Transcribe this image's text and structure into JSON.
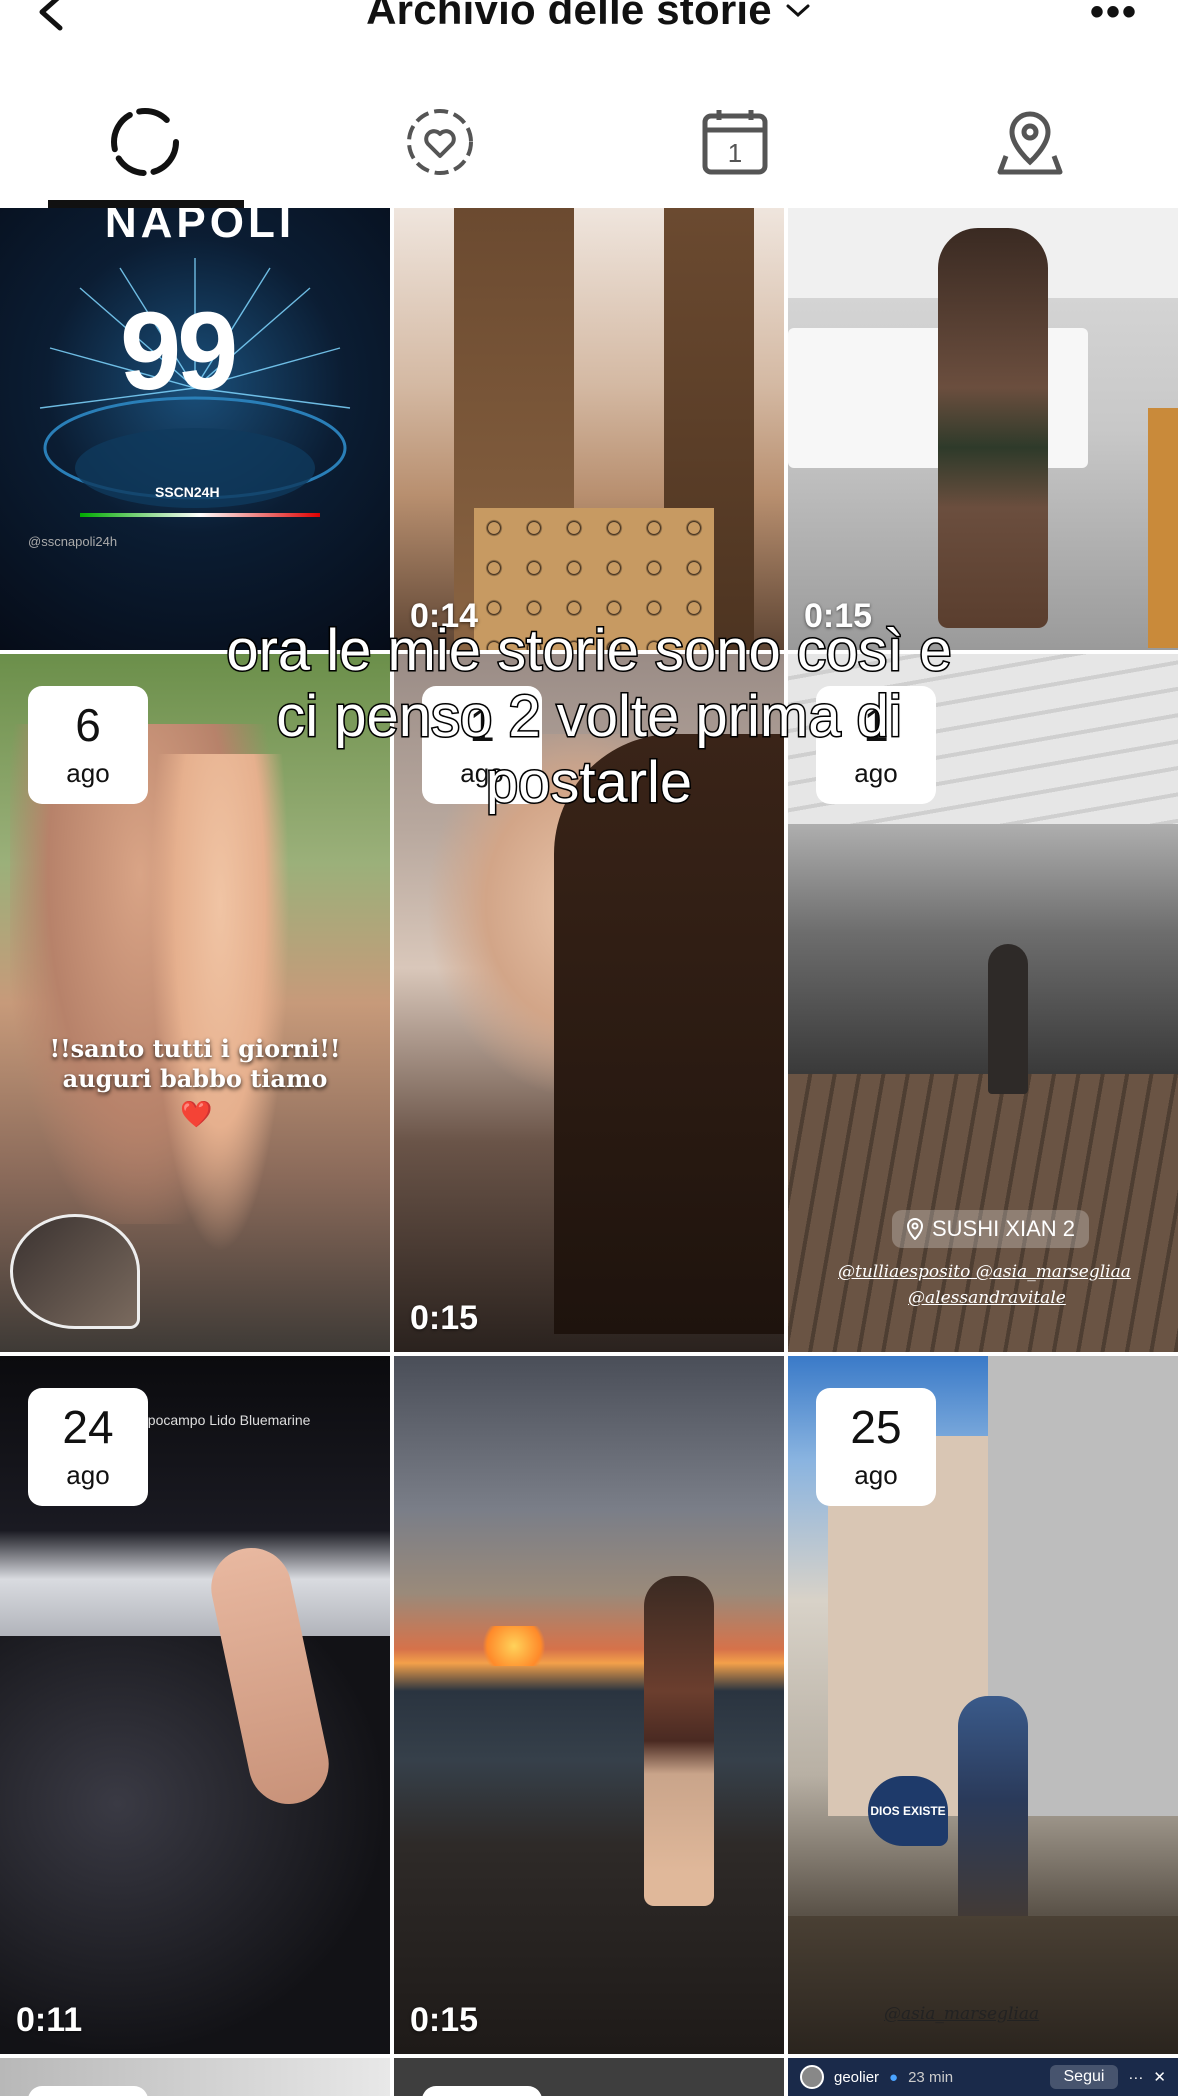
{
  "header": {
    "title": "Archivio delle storie",
    "back_icon": "chevron-left-icon",
    "more_label": "•••"
  },
  "tabs": [
    {
      "name": "all-stories",
      "icon": "loading-circle-icon",
      "active": true
    },
    {
      "name": "highlights",
      "icon": "heart-circle-icon",
      "active": false
    },
    {
      "name": "calendar",
      "icon": "calendar-icon",
      "day": "1",
      "active": false
    },
    {
      "name": "map",
      "icon": "location-pin-icon",
      "active": false
    }
  ],
  "overlay_caption": [
    "ora le mie storie sono così e",
    "ci penso 2 volte prima di",
    "postarle"
  ],
  "grid": {
    "row1": [
      {
        "text_big": "99",
        "text_small": "SSCN24H",
        "handle": "@sscnapoli24h",
        "title_frag": "NAPOLI"
      },
      {
        "duration": "0:14"
      },
      {
        "duration": "0:15"
      }
    ],
    "row2": [
      {
        "day": "6",
        "month": "ago",
        "caption_line1": "!!santo tutti i giorni!!",
        "caption_line2": "auguri babbo tiamo",
        "heart": "❤️"
      },
      {
        "day": "1",
        "month": "ago",
        "duration": "0:15"
      },
      {
        "day": "1",
        "month": "ago",
        "location": "SUSHI XIAN 2",
        "tags_line1": "@tulliaesposito  @asia_marsegliaa",
        "tags_line2": "@alessandravitale"
      }
    ],
    "row3": [
      {
        "day": "24",
        "month": "ago",
        "location_text": "ppocampo Lido Bluemarine",
        "duration": "0:11"
      },
      {
        "duration": "0:15"
      },
      {
        "day": "25",
        "month": "ago",
        "sign": "DIOS EXISTE",
        "tag": "@asia_marsegliaa"
      }
    ],
    "row4": [
      {},
      {},
      {
        "user": "geolier",
        "time": "23 min",
        "follow": "Segui",
        "more": "···",
        "close": "✕"
      }
    ]
  },
  "colors": {
    "background": "#ffffff",
    "text": "#111111",
    "overlay_text": "#ffffff"
  }
}
